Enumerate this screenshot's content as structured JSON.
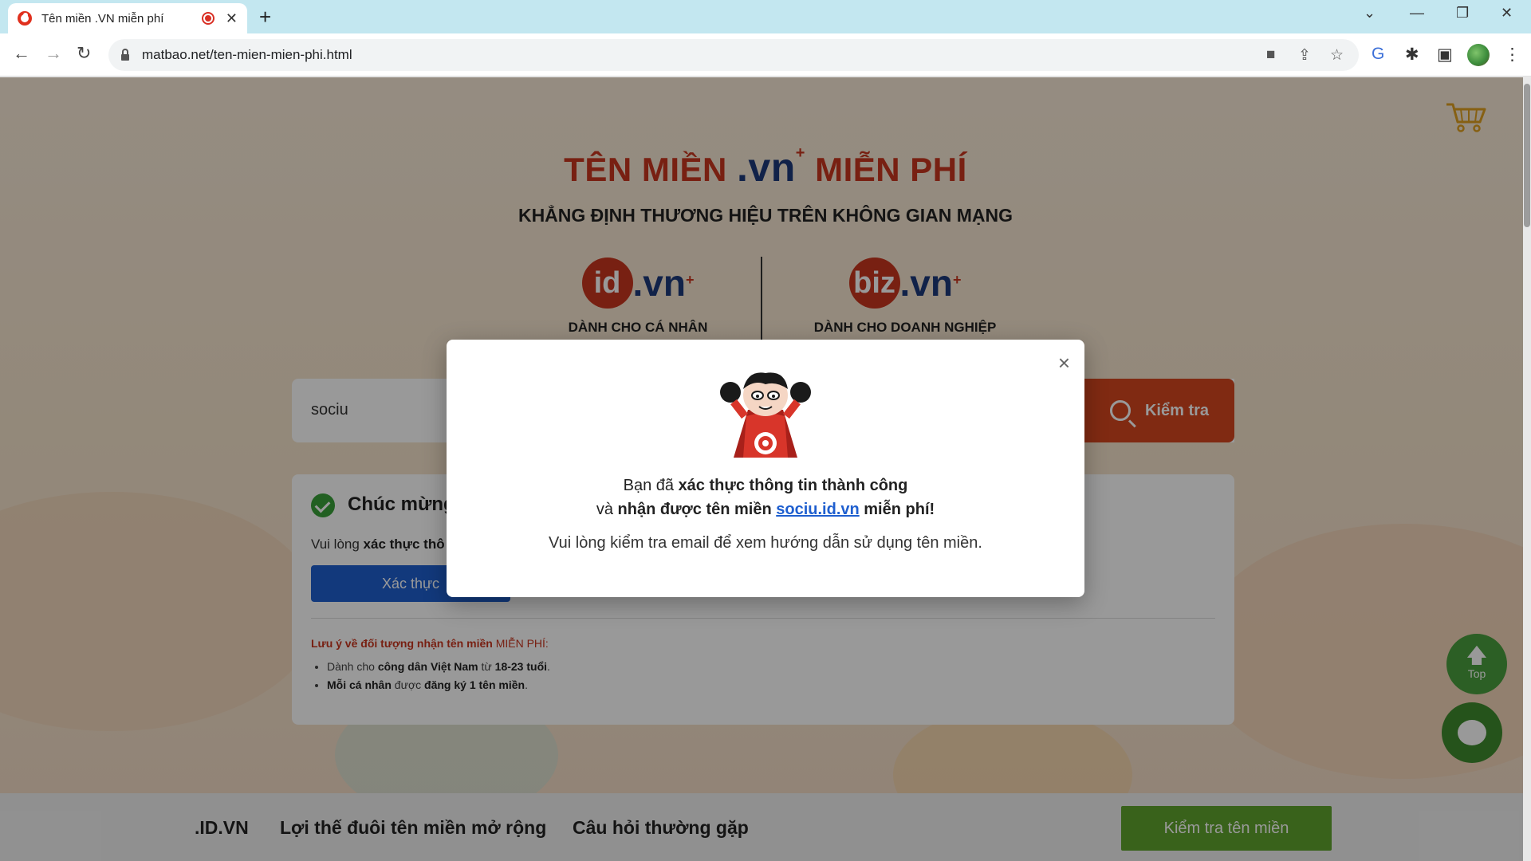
{
  "browser": {
    "tab_title": "Tên miền .VN miễn phí",
    "new_tab": "+",
    "url": "matbao.net/ten-mien-mien-phi.html"
  },
  "hero": {
    "title_left": "TÊN MIỀN ",
    "title_vn": ".vn",
    "title_star": "+",
    "title_right": " MIỄN PHÍ",
    "subtitle": "KHẲNG ĐỊNH THƯƠNG HIỆU TRÊN KHÔNG GIAN MẠNG"
  },
  "brands": [
    {
      "circle": "id",
      "suffix": ".vn",
      "star": "+",
      "label": "DÀNH CHO CÁ NHÂN"
    },
    {
      "circle": "biz",
      "suffix": ".vn",
      "star": "+",
      "label": "DÀNH CHO DOANH NGHIỆP"
    }
  ],
  "search": {
    "value": "sociu",
    "button_label": "Kiểm tra"
  },
  "result": {
    "title": "Chúc mừng",
    "verify_prefix": "Vui lòng ",
    "verify_bold": "xác thực thô",
    "verify_button": "Xác thực",
    "note_title": "Lưu ý về đối tượng nhận tên miền ",
    "note_title_suffix": "MIỄN PHÍ:",
    "notes": [
      {
        "pre": "Dành cho ",
        "bold": "công dân Việt Nam",
        "mid": " từ ",
        "bold2": "18-23 tuổi",
        "post": "."
      },
      {
        "pre": "",
        "bold": "Mỗi cá nhân",
        "mid": " được ",
        "bold2": "đăng ký 1 tên miền",
        "post": "."
      }
    ]
  },
  "bottom_nav": {
    "items": [
      ".ID.VN",
      "Lợi thế đuôi tên miền mở rộng",
      "Câu hỏi thường gặp"
    ],
    "check_button": "Kiểm tra tên miền"
  },
  "floating": {
    "top_arrow": "🡅",
    "top_label": "Top"
  },
  "modal": {
    "close": "×",
    "line1_pre": "Bạn đã ",
    "line1_bold": "xác thực thông tin thành công",
    "line2_pre": "và ",
    "line2_bold": "nhận được tên miền ",
    "line2_link": "sociu.id.vn",
    "line2_post": " miễn phí!",
    "line3": "Vui lòng kiểm tra email để xem hướng dẫn sử dụng tên miền."
  },
  "colors": {
    "brand_red": "#c8361f",
    "brand_navy": "#1d3a7a",
    "primary_blue": "#1f5fcf",
    "green": "#5fa32e"
  }
}
